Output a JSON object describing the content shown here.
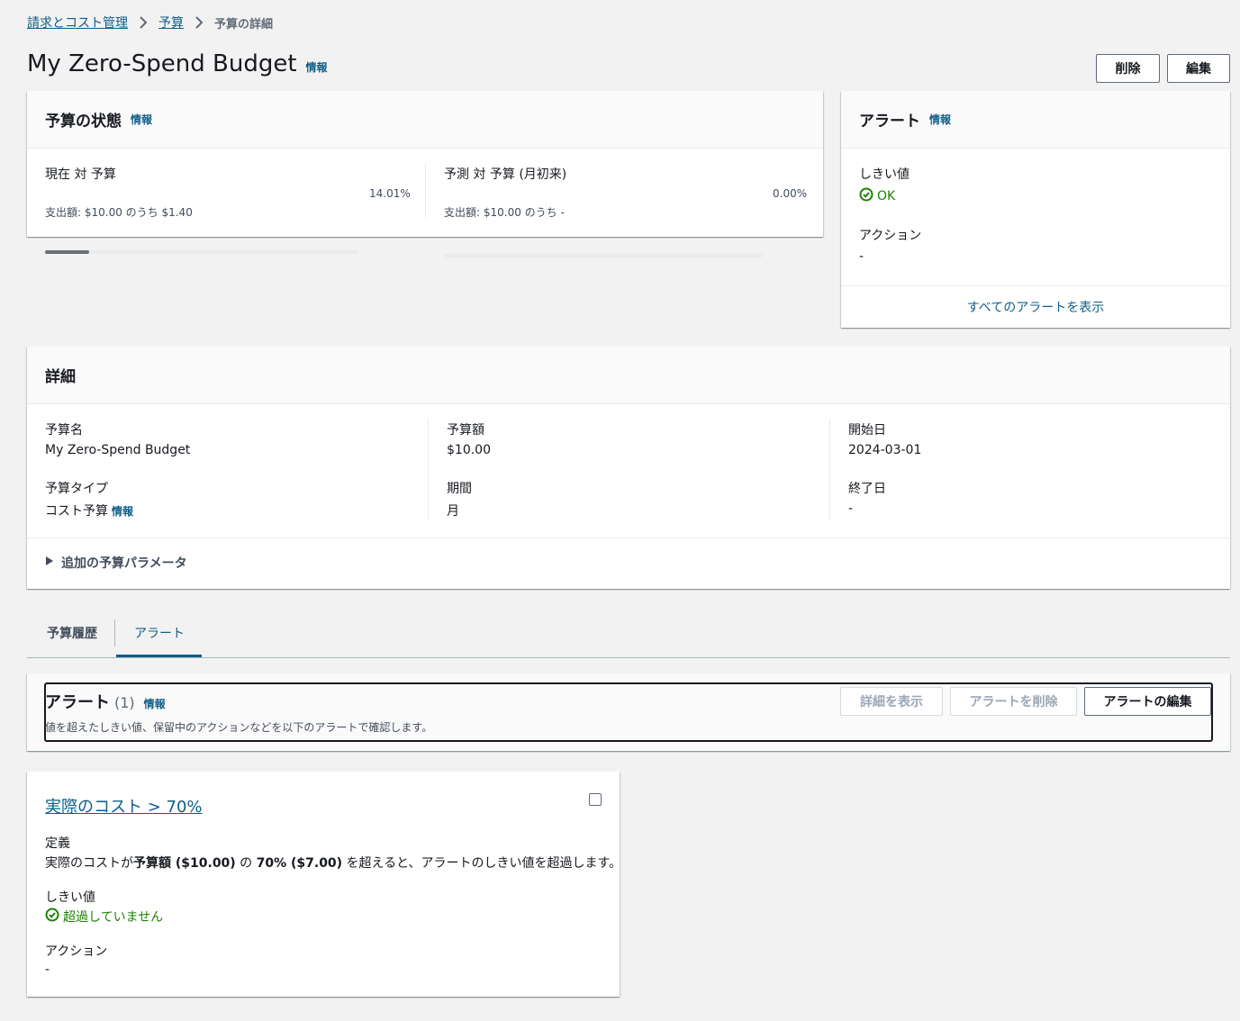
{
  "breadcrumb": {
    "items": [
      "請求とコスト管理",
      "予算"
    ],
    "current": "予算の詳細"
  },
  "page": {
    "title": "My Zero-Spend Budget",
    "info": "情報",
    "delete_label": "削除",
    "edit_label": "編集"
  },
  "status_card": {
    "title": "予算の状態",
    "info": "情報",
    "current": {
      "label": "現在 対 予算",
      "percent": "14.01%",
      "progress": 0.1401,
      "detail": "支出額: $10.00 のうち $1.40"
    },
    "forecast": {
      "label": "予測 対 予算 (月初来)",
      "percent": "0.00%",
      "progress": 0,
      "detail": "支出額: $10.00 のうち -"
    }
  },
  "alert_card": {
    "title": "アラート",
    "info": "情報",
    "threshold_label": "しきい値",
    "threshold_value": "OK",
    "action_label": "アクション",
    "action_value": "-",
    "view_all": "すべてのアラートを表示"
  },
  "details": {
    "title": "詳細",
    "budget_name_label": "予算名",
    "budget_name": "My Zero-Spend Budget",
    "budget_type_label": "予算タイプ",
    "budget_type": "コスト予算",
    "budget_type_info": "情報",
    "amount_label": "予算額",
    "amount": "$10.00",
    "period_label": "期間",
    "period": "月",
    "start_label": "開始日",
    "start": "2024-03-01",
    "end_label": "終了日",
    "end": "-",
    "expand_label": "追加の予算パラメータ"
  },
  "tabs": {
    "history": "予算履歴",
    "alerts": "アラート"
  },
  "alerts_section": {
    "title": "アラート",
    "count": "(1)",
    "info": "情報",
    "description": "値を超えたしきい値、保留中のアクションなどを以下のアラートで確認します。",
    "view_details": "詳細を表示",
    "delete_alert": "アラートを削除",
    "edit_alert": "アラートの編集"
  },
  "alert_item": {
    "title": "実際のコスト > 70%",
    "definition_label": "定義",
    "def_part1": "実際のコストが",
    "def_bold1": "予算額 ($10.00)",
    "def_part2": " の ",
    "def_bold2": "70% ($7.00)",
    "def_part3": " を超えると、アラートのしきい値を超過します。",
    "threshold_label": "しきい値",
    "threshold_value": "超過していません",
    "action_label": "アクション",
    "action_value": "-"
  },
  "colors": {
    "link": "#0f5e8a",
    "success": "#1d8102",
    "background": "#f2f2f2"
  }
}
